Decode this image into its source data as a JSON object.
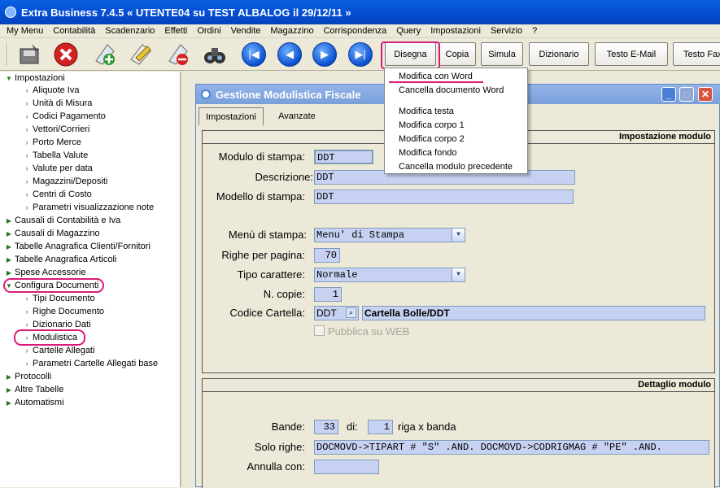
{
  "app": {
    "title": "Extra Business 7.4.5  « UTENTE04 su TEST ALBALOG il 29/12/11 »"
  },
  "menubar": [
    "My Menu",
    "Contabilità",
    "Scadenzario",
    "Effetti",
    "Ordini",
    "Vendite",
    "Magazzino",
    "Corrispondenza",
    "Query",
    "Impostazioni",
    "Servizio",
    "?"
  ],
  "toolbar": {
    "buttons": [
      "Disegna",
      "Copia",
      "Simula",
      "Dizionario",
      "Testo E-Mail",
      "Testo Fax"
    ]
  },
  "sidebar": {
    "items": [
      {
        "label": "Impostazioni"
      },
      {
        "label": "Aliquote Iva"
      },
      {
        "label": "Unità di Misura"
      },
      {
        "label": "Codici Pagamento"
      },
      {
        "label": "Vettori/Corrieri"
      },
      {
        "label": "Porto Merce"
      },
      {
        "label": "Tabella Valute"
      },
      {
        "label": "Valute per data"
      },
      {
        "label": "Magazzini/Depositi"
      },
      {
        "label": "Centri di Costo"
      },
      {
        "label": "Parametri visualizzazione note"
      },
      {
        "label": "Causali di Contabilità e Iva"
      },
      {
        "label": "Causali di Magazzino"
      },
      {
        "label": "Tabelle Anagrafica Clienti/Fornitori"
      },
      {
        "label": "Tabelle Anagrafica Articoli"
      },
      {
        "label": "Spese Accessorie"
      },
      {
        "label": "Configura Documenti"
      },
      {
        "label": "Tipi Documento"
      },
      {
        "label": "Righe Documento"
      },
      {
        "label": "Dizionario Dati"
      },
      {
        "label": "Modulistica"
      },
      {
        "label": "Cartelle Allegati"
      },
      {
        "label": "Parametri Cartelle Allegati base"
      },
      {
        "label": "Protocolli"
      },
      {
        "label": "Altre Tabelle"
      },
      {
        "label": "Automatismi"
      }
    ]
  },
  "window": {
    "title": "Gestione Modulistica Fiscale",
    "tabs": [
      "Impostazioni",
      "Avanzate"
    ],
    "section1": {
      "header": "Impostazione modulo"
    },
    "section2": {
      "header": "Dettaglio modulo"
    },
    "fields": {
      "modulo_label": "Modulo di stampa:",
      "modulo_value": "DDT",
      "descrizione_label": "Descrizione:",
      "descrizione_value": "DDT",
      "modello_label": "Modello di stampa:",
      "modello_value": "DDT",
      "menu_label": "Menù di stampa:",
      "menu_value": "Menu' di Stampa",
      "righe_label": "Righe per pagina:",
      "righe_value": "70",
      "tipo_label": "Tipo carattere:",
      "tipo_value": "Normale",
      "copie_label": "N. copie:",
      "copie_value": "1",
      "cartella_label": "Codice Cartella:",
      "cartella_code": "DDT",
      "cartella_desc": "Cartella Bolle/DDT",
      "pubblica_label": "Pubblica su WEB",
      "bande_label": "Bande:",
      "bande_value": "33",
      "di_label": "di:",
      "di_value": "1",
      "riga_label": "riga x banda",
      "solo_label": "Solo righe:",
      "solo_value": "DOCMOVD->TIPART # \"S\" .AND. DOCMOVD->CODRIGMAG # \"PE\" .AND.",
      "annulla_label": "Annulla con:",
      "annulla_value": ""
    }
  },
  "dropdown": {
    "items": [
      "Modifica con Word",
      "Cancella documento Word",
      "Modifica testa",
      "Modifica corpo 1",
      "Modifica corpo 2",
      "Modifica fondo",
      "Cancella modulo precedente"
    ]
  },
  "colors": {
    "highlight": "#d81b7a",
    "title_blue": "#0550d6",
    "field_bg": "#c7d2f2"
  }
}
